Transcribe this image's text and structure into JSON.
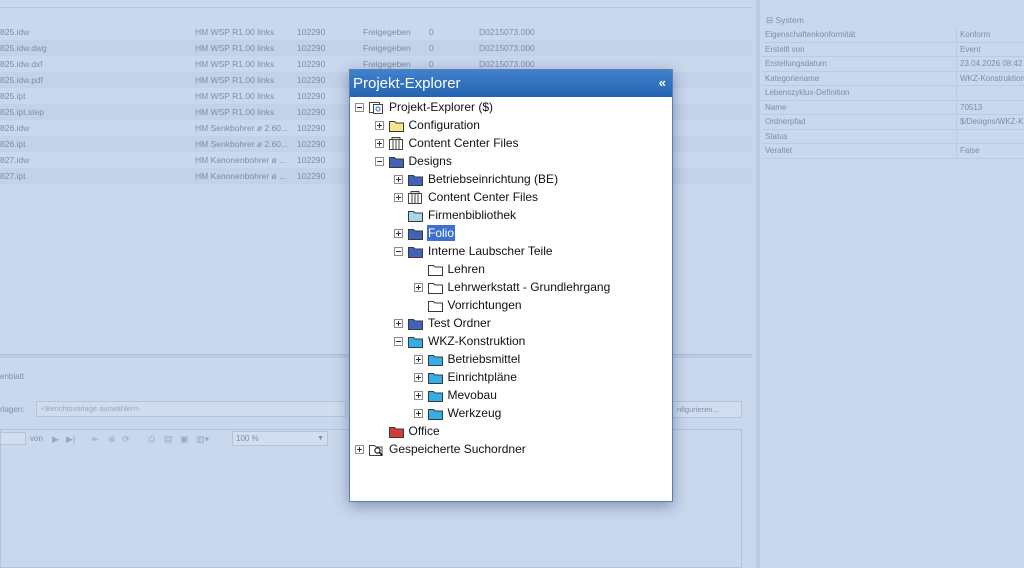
{
  "background": {
    "table_rows": [
      {
        "file": "825.idw",
        "name": "HM WSP R1.00 links",
        "number": "102290",
        "status": "Freigegeben",
        "version": "0",
        "doc": "D0215073.000"
      },
      {
        "file": "825.idw.dwg",
        "name": "HM WSP R1.00 links",
        "number": "102290",
        "status": "Freigegeben",
        "version": "0",
        "doc": "D0215073.000"
      },
      {
        "file": "825.idw.dxf",
        "name": "HM WSP R1.00 links",
        "number": "102290",
        "status": "Freigegeben",
        "version": "0",
        "doc": "D0215073.000"
      },
      {
        "file": "825.idw.pdf",
        "name": "HM WSP R1.00 links",
        "number": "102290",
        "status": "Freigegeben",
        "version": "0",
        "doc": "D0215073.000"
      },
      {
        "file": "825.ipt",
        "name": "HM WSP R1.00 links",
        "number": "102290",
        "status": "Freigegeben",
        "version": "0",
        "doc": "D0215073.000"
      },
      {
        "file": "825.ipt.step",
        "name": "HM WSP R1.00 links",
        "number": "102290",
        "status": "Freigegeben",
        "version": "0",
        "doc": "D0215073.000"
      },
      {
        "file": "826.idw",
        "name": "HM Senkbohrer ø 2.60...",
        "number": "102290",
        "status": "",
        "version": "",
        "doc": ""
      },
      {
        "file": "826.ipt",
        "name": "HM Senkbohrer ø 2.60...",
        "number": "102290",
        "status": "",
        "version": "",
        "doc": ""
      },
      {
        "file": "827.idw",
        "name": "HM Kanonenbohrer ø ...",
        "number": "102290",
        "status": "",
        "version": "",
        "doc": ""
      },
      {
        "file": "827.ipt",
        "name": "HM Kanonenbohrer ø ...",
        "number": "102290",
        "status": "",
        "version": "",
        "doc": ""
      }
    ],
    "lower_tab": "enblatt",
    "vorlagen_label": "rlagen:",
    "vorlagen_placeholder": "<Berichtsvorlage auswählen>",
    "konfigurieren_label": "nfigurieren...",
    "pager_von": "von",
    "zoom_value": "100 %",
    "system_header": "System",
    "properties": [
      {
        "key": "Eigenschaftenkonformität",
        "value": "Konform"
      },
      {
        "key": "Erstellt von",
        "value": "Event"
      },
      {
        "key": "Erstellungsdatum",
        "value": "23.04.2026 08:42"
      },
      {
        "key": "Kategoriename",
        "value": "WKZ-Konstruktion"
      },
      {
        "key": "Lebenszyklus-Definition",
        "value": ""
      },
      {
        "key": "Name",
        "value": "70513"
      },
      {
        "key": "Ordnerpfad",
        "value": "$/Designs/WKZ-K..."
      },
      {
        "key": "Status",
        "value": ""
      },
      {
        "key": "Veraltet",
        "value": "False"
      }
    ]
  },
  "explorer": {
    "title": "Projekt-Explorer",
    "collapse_glyph": "«",
    "nodes": [
      {
        "id": "root",
        "label": "Projekt-Explorer ($)",
        "level": 0,
        "expander": "minus",
        "icon": "vault-icon",
        "color": "#ffffff"
      },
      {
        "id": "configuration",
        "label": "Configuration",
        "level": 1,
        "expander": "plus",
        "icon": "folder-icon",
        "color": "#f6e58d"
      },
      {
        "id": "content-center-files",
        "label": "Content Center Files",
        "level": 1,
        "expander": "plus",
        "icon": "library-icon",
        "color": "#ffffff"
      },
      {
        "id": "designs",
        "label": "Designs",
        "level": 1,
        "expander": "minus",
        "icon": "folder-icon",
        "color": "#3f63b8"
      },
      {
        "id": "betriebseinrichtung",
        "label": "Betriebseinrichtung (BE)",
        "level": 2,
        "expander": "plus",
        "icon": "folder-icon",
        "color": "#3f63b8"
      },
      {
        "id": "designs-content-center-files",
        "label": "Content Center Files",
        "level": 2,
        "expander": "plus",
        "icon": "library-icon",
        "color": "#ffffff"
      },
      {
        "id": "firmenbibliothek",
        "label": "Firmenbibliothek",
        "level": 2,
        "expander": "none",
        "icon": "folder-icon",
        "color": "#a9d6e8"
      },
      {
        "id": "folio",
        "label": "Folio",
        "level": 2,
        "expander": "plus",
        "icon": "folder-icon",
        "color": "#3f63b8",
        "selected": true
      },
      {
        "id": "interne-laubscher-teile",
        "label": "Interne Laubscher Teile",
        "level": 2,
        "expander": "minus",
        "icon": "folder-icon",
        "color": "#3f63b8"
      },
      {
        "id": "lehren",
        "label": "Lehren",
        "level": 3,
        "expander": "none",
        "icon": "folder-icon",
        "color": "#ffffff"
      },
      {
        "id": "lehrwerkstatt",
        "label": "Lehrwerkstatt - Grundlehrgang",
        "level": 3,
        "expander": "plus",
        "icon": "folder-icon",
        "color": "#ffffff"
      },
      {
        "id": "vorrichtungen",
        "label": "Vorrichtungen",
        "level": 3,
        "expander": "none",
        "icon": "folder-icon",
        "color": "#ffffff"
      },
      {
        "id": "test-ordner",
        "label": "Test Ordner",
        "level": 2,
        "expander": "plus",
        "icon": "folder-icon",
        "color": "#3f63b8"
      },
      {
        "id": "wkz-konstruktion",
        "label": "WKZ-Konstruktion",
        "level": 2,
        "expander": "minus",
        "icon": "folder-icon",
        "color": "#35aee6"
      },
      {
        "id": "betriebsmittel",
        "label": "Betriebsmittel",
        "level": 3,
        "expander": "plus",
        "icon": "folder-icon",
        "color": "#35aee6"
      },
      {
        "id": "einrichtplaene",
        "label": "Einrichtpläne",
        "level": 3,
        "expander": "plus",
        "icon": "folder-icon",
        "color": "#35aee6"
      },
      {
        "id": "mevobau",
        "label": "Mevobau",
        "level": 3,
        "expander": "plus",
        "icon": "folder-icon",
        "color": "#35aee6"
      },
      {
        "id": "werkzeug",
        "label": "Werkzeug",
        "level": 3,
        "expander": "plus",
        "icon": "folder-icon",
        "color": "#35aee6"
      },
      {
        "id": "office",
        "label": "Office",
        "level": 1,
        "expander": "none",
        "icon": "folder-icon",
        "color": "#d33a3a"
      },
      {
        "id": "gespeicherte-suchordner",
        "label": "Gespeicherte Suchordner",
        "level": 0,
        "expander": "plus",
        "icon": "search-folder-icon",
        "color": "#ffffff"
      }
    ]
  }
}
